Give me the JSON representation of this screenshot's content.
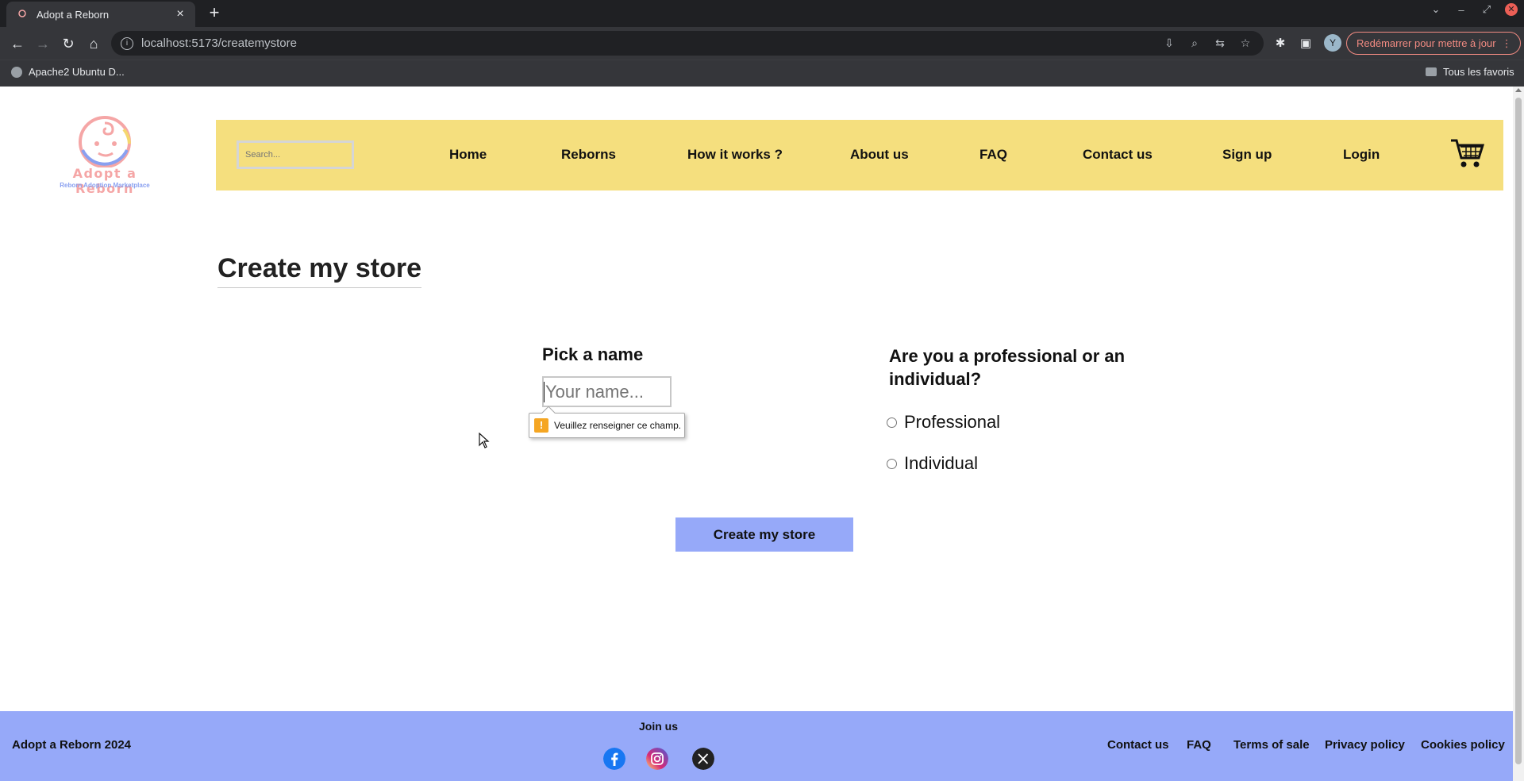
{
  "browser": {
    "tab_title": "Adopt a Reborn",
    "tab_close": "×",
    "new_tab": "+",
    "url": "localhost:5173/createmystore",
    "update_button": "Redémarrer pour mettre à jour",
    "update_menu": "⋮",
    "avatar_letter": "Y",
    "bookmarks": [
      {
        "label": "Apache2 Ubuntu D..."
      }
    ],
    "all_bookmarks": "Tous les favoris",
    "window_controls": {
      "collapse": "⌄",
      "minimize": "–",
      "restore": "⤢",
      "close": "✕"
    },
    "nav_icons": {
      "back": "←",
      "forward": "→",
      "reload": "↻",
      "home": "⌂"
    },
    "omni_icons": {
      "install": "⇩",
      "zoom": "⌕",
      "share": "⇆",
      "bookmark": "☆"
    },
    "tool_icons": {
      "extensions": "✱",
      "side_panel": "▣"
    },
    "info_icon": "i"
  },
  "site": {
    "logo_text": "Adopt a Reborn",
    "logo_sub": "Reborn Adoption Marketplace",
    "search_placeholder": "Search...",
    "nav": [
      {
        "label": "Home"
      },
      {
        "label": "Reborns"
      },
      {
        "label": "How it works ?"
      },
      {
        "label": "About us"
      },
      {
        "label": "FAQ"
      },
      {
        "label": "Contact us"
      },
      {
        "label": "Sign up"
      },
      {
        "label": "Login"
      }
    ],
    "colors": {
      "navbar": "#f5df7e",
      "footer": "#96a9f9",
      "button": "#96a9f9"
    }
  },
  "main": {
    "title": "Create my store",
    "name_label": "Pick a name",
    "name_placeholder": "Your name...",
    "name_value": "",
    "validation_icon": "!",
    "validation_message": "Veuillez renseigner ce champ.",
    "type_question": "Are you a professional or an individual?",
    "options": [
      {
        "label": "Professional",
        "checked": false
      },
      {
        "label": "Individual",
        "checked": false
      }
    ],
    "submit_label": "Create my store"
  },
  "footer": {
    "copyright": "Adopt a Reborn 2024",
    "join_us": "Join us",
    "socials": [
      "facebook-icon",
      "instagram-icon",
      "x-icon"
    ],
    "links": [
      {
        "label": "Contact us"
      },
      {
        "label": "FAQ"
      },
      {
        "label": "Terms of sale"
      },
      {
        "label": "Privacy policy"
      },
      {
        "label": "Cookies policy"
      }
    ]
  }
}
